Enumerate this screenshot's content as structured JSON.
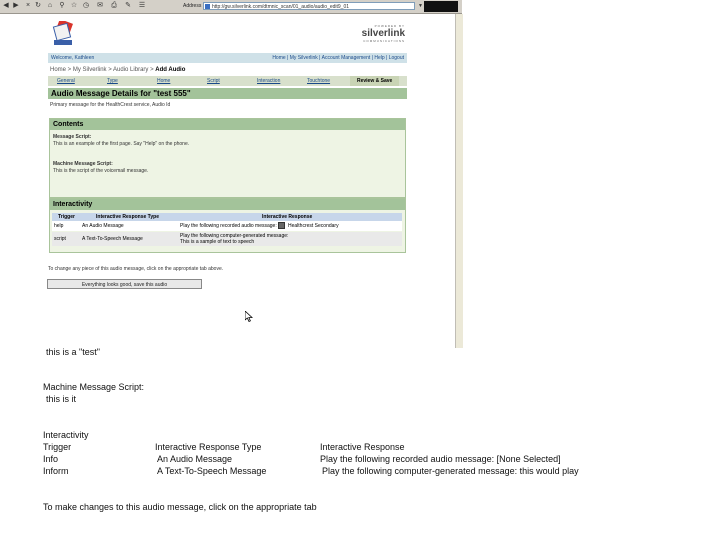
{
  "browser": {
    "address_label": "Address",
    "url": "http://gw.silverlink.com/dtmnic_scan/01_audio/audio_edit9_01",
    "colors": {
      "chrome": "#d4d0c8",
      "accent": "#a3c39a",
      "link": "#1a4a8a"
    },
    "toolbar_icons": [
      "back-icon",
      "forward-icon",
      "stop-icon",
      "refresh-icon",
      "home-icon",
      "search-icon",
      "favorites-icon",
      "history-icon",
      "mail-icon",
      "print-icon",
      "edit-icon",
      "discuss-icon"
    ]
  },
  "header": {
    "logo_text": "Healthy",
    "powered_by": "POWERED BY",
    "brand": "silverlink",
    "brand_sub": "COMMUNICATIONS",
    "welcome": "Welcome, Kathleen",
    "links": [
      "Home",
      "My Silverlink",
      "Account Management",
      "Help",
      "Logout"
    ],
    "link_sep": " | "
  },
  "breadcrumb": {
    "items": [
      "Home",
      "My Silverlink",
      "Audio Library"
    ],
    "sep": " > ",
    "current": "Add Audio"
  },
  "tabs": {
    "items": [
      "General",
      "Type",
      "Home",
      "Script",
      "Interaction",
      "Touchtone"
    ],
    "active": "Review & Save"
  },
  "details": {
    "title": "Audio Message Details for \"test 555\"",
    "primary": "Primary message for the HealthCrest service, Audio Id"
  },
  "contents": {
    "title": "Contents",
    "message_script_label": "Message Script:",
    "message_script": "This is an example of the first page. Say \"Help\" on the phone.",
    "machine_script_label": "Machine Message Script:",
    "machine_script": "This is the script of the voicemail message."
  },
  "interactivity": {
    "title": "Interactivity",
    "columns": [
      "Trigger",
      "Interactive Response Type",
      "Interactive Response"
    ],
    "rows": [
      {
        "trigger": "help",
        "type": "An Audio Message",
        "response": "Play the following recorded audio message:",
        "extra": "Healthcrest Secondary"
      },
      {
        "trigger": "script",
        "type": "A Text-To-Speech Message",
        "response": "Play the following computer-generated message:",
        "extra": "This is a sample of text to speech"
      }
    ]
  },
  "footer": {
    "to_change": "To change any piece of this audio message, click on the appropriate tab above.",
    "save_button": "Everything looks good, save this audio"
  },
  "transcript": {
    "line1": "this is a \"test\"",
    "machine_label": "Machine Message Script:",
    "machine_value": "this is it",
    "interactivity": "Interactivity",
    "col_trigger": "Trigger",
    "col_type": "Interactive Response Type",
    "col_response": "Interactive Response",
    "r1_trigger": "Info",
    "r1_type": "An Audio Message",
    "r1_response": "Play the following recorded audio message: [None Selected]",
    "r2_trigger": "Inform",
    "r2_type": "A Text-To-Speech Message",
    "r2_response": "Play the following computer-generated message: this would play",
    "to_change": "To make changes to this audio message, click on the appropriate tab"
  }
}
